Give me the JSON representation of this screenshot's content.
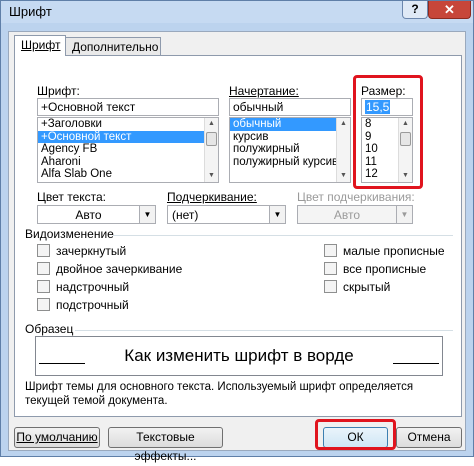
{
  "window": {
    "title": "Шрифт",
    "help_glyph": "?",
    "close_glyph": "✕"
  },
  "tabs": [
    {
      "label": "Шрифт"
    },
    {
      "label": "Дополнительно"
    }
  ],
  "font": {
    "label": "Шрифт:",
    "value": "+Основной текст",
    "items": [
      "+Заголовки",
      "+Основной текст",
      "Agency FB",
      "Aharoni",
      "Alfa Slab One"
    ],
    "selected_index": 1
  },
  "style": {
    "label": "Начертание:",
    "value": "обычный",
    "items": [
      "обычный",
      "курсив",
      "полужирный",
      "полужирный курсив"
    ],
    "selected_index": 0
  },
  "size": {
    "label": "Размер:",
    "value": "15,5",
    "items": [
      "8",
      "9",
      "10",
      "11",
      "12"
    ]
  },
  "text_color": {
    "label": "Цвет текста:",
    "value": "Авто"
  },
  "underline": {
    "label": "Подчеркивание:",
    "value": "(нет)"
  },
  "underline_color": {
    "label": "Цвет подчеркивания:",
    "value": "Авто"
  },
  "effects": {
    "label": "Видоизменение",
    "left": [
      "зачеркнутый",
      "двойное зачеркивание",
      "надстрочный",
      "подстрочный"
    ],
    "right": [
      "малые прописные",
      "все прописные",
      "скрытый"
    ]
  },
  "sample": {
    "label": "Образец",
    "text": "Как изменить шрифт в ворде",
    "note": "Шрифт темы для основного текста. Используемый шрифт определяется текущей темой документа."
  },
  "buttons": {
    "default": "По умолчанию",
    "text_effects": "Текстовые эффекты...",
    "ok": "ОК",
    "cancel": "Отмена"
  },
  "colors": {
    "highlight": "#e0141e",
    "selection": "#3399ff",
    "close": "#c7463a"
  }
}
